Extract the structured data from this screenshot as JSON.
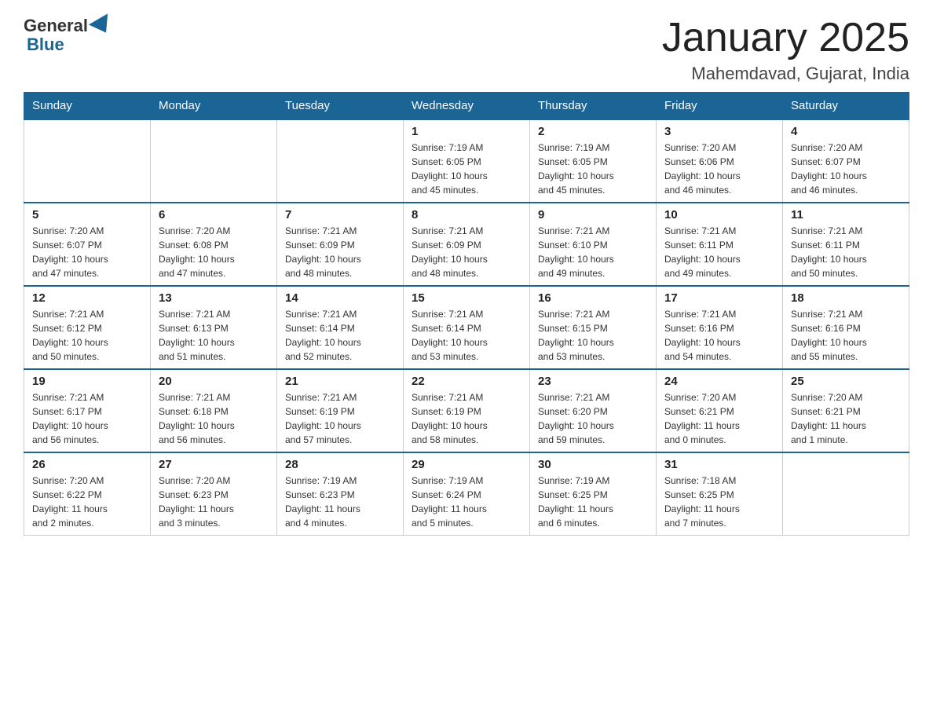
{
  "header": {
    "logo_general": "General",
    "logo_blue": "Blue",
    "month_title": "January 2025",
    "location": "Mahemdavad, Gujarat, India"
  },
  "weekdays": [
    "Sunday",
    "Monday",
    "Tuesday",
    "Wednesday",
    "Thursday",
    "Friday",
    "Saturday"
  ],
  "weeks": [
    [
      {
        "day": "",
        "info": ""
      },
      {
        "day": "",
        "info": ""
      },
      {
        "day": "",
        "info": ""
      },
      {
        "day": "1",
        "info": "Sunrise: 7:19 AM\nSunset: 6:05 PM\nDaylight: 10 hours\nand 45 minutes."
      },
      {
        "day": "2",
        "info": "Sunrise: 7:19 AM\nSunset: 6:05 PM\nDaylight: 10 hours\nand 45 minutes."
      },
      {
        "day": "3",
        "info": "Sunrise: 7:20 AM\nSunset: 6:06 PM\nDaylight: 10 hours\nand 46 minutes."
      },
      {
        "day": "4",
        "info": "Sunrise: 7:20 AM\nSunset: 6:07 PM\nDaylight: 10 hours\nand 46 minutes."
      }
    ],
    [
      {
        "day": "5",
        "info": "Sunrise: 7:20 AM\nSunset: 6:07 PM\nDaylight: 10 hours\nand 47 minutes."
      },
      {
        "day": "6",
        "info": "Sunrise: 7:20 AM\nSunset: 6:08 PM\nDaylight: 10 hours\nand 47 minutes."
      },
      {
        "day": "7",
        "info": "Sunrise: 7:21 AM\nSunset: 6:09 PM\nDaylight: 10 hours\nand 48 minutes."
      },
      {
        "day": "8",
        "info": "Sunrise: 7:21 AM\nSunset: 6:09 PM\nDaylight: 10 hours\nand 48 minutes."
      },
      {
        "day": "9",
        "info": "Sunrise: 7:21 AM\nSunset: 6:10 PM\nDaylight: 10 hours\nand 49 minutes."
      },
      {
        "day": "10",
        "info": "Sunrise: 7:21 AM\nSunset: 6:11 PM\nDaylight: 10 hours\nand 49 minutes."
      },
      {
        "day": "11",
        "info": "Sunrise: 7:21 AM\nSunset: 6:11 PM\nDaylight: 10 hours\nand 50 minutes."
      }
    ],
    [
      {
        "day": "12",
        "info": "Sunrise: 7:21 AM\nSunset: 6:12 PM\nDaylight: 10 hours\nand 50 minutes."
      },
      {
        "day": "13",
        "info": "Sunrise: 7:21 AM\nSunset: 6:13 PM\nDaylight: 10 hours\nand 51 minutes."
      },
      {
        "day": "14",
        "info": "Sunrise: 7:21 AM\nSunset: 6:14 PM\nDaylight: 10 hours\nand 52 minutes."
      },
      {
        "day": "15",
        "info": "Sunrise: 7:21 AM\nSunset: 6:14 PM\nDaylight: 10 hours\nand 53 minutes."
      },
      {
        "day": "16",
        "info": "Sunrise: 7:21 AM\nSunset: 6:15 PM\nDaylight: 10 hours\nand 53 minutes."
      },
      {
        "day": "17",
        "info": "Sunrise: 7:21 AM\nSunset: 6:16 PM\nDaylight: 10 hours\nand 54 minutes."
      },
      {
        "day": "18",
        "info": "Sunrise: 7:21 AM\nSunset: 6:16 PM\nDaylight: 10 hours\nand 55 minutes."
      }
    ],
    [
      {
        "day": "19",
        "info": "Sunrise: 7:21 AM\nSunset: 6:17 PM\nDaylight: 10 hours\nand 56 minutes."
      },
      {
        "day": "20",
        "info": "Sunrise: 7:21 AM\nSunset: 6:18 PM\nDaylight: 10 hours\nand 56 minutes."
      },
      {
        "day": "21",
        "info": "Sunrise: 7:21 AM\nSunset: 6:19 PM\nDaylight: 10 hours\nand 57 minutes."
      },
      {
        "day": "22",
        "info": "Sunrise: 7:21 AM\nSunset: 6:19 PM\nDaylight: 10 hours\nand 58 minutes."
      },
      {
        "day": "23",
        "info": "Sunrise: 7:21 AM\nSunset: 6:20 PM\nDaylight: 10 hours\nand 59 minutes."
      },
      {
        "day": "24",
        "info": "Sunrise: 7:20 AM\nSunset: 6:21 PM\nDaylight: 11 hours\nand 0 minutes."
      },
      {
        "day": "25",
        "info": "Sunrise: 7:20 AM\nSunset: 6:21 PM\nDaylight: 11 hours\nand 1 minute."
      }
    ],
    [
      {
        "day": "26",
        "info": "Sunrise: 7:20 AM\nSunset: 6:22 PM\nDaylight: 11 hours\nand 2 minutes."
      },
      {
        "day": "27",
        "info": "Sunrise: 7:20 AM\nSunset: 6:23 PM\nDaylight: 11 hours\nand 3 minutes."
      },
      {
        "day": "28",
        "info": "Sunrise: 7:19 AM\nSunset: 6:23 PM\nDaylight: 11 hours\nand 4 minutes."
      },
      {
        "day": "29",
        "info": "Sunrise: 7:19 AM\nSunset: 6:24 PM\nDaylight: 11 hours\nand 5 minutes."
      },
      {
        "day": "30",
        "info": "Sunrise: 7:19 AM\nSunset: 6:25 PM\nDaylight: 11 hours\nand 6 minutes."
      },
      {
        "day": "31",
        "info": "Sunrise: 7:18 AM\nSunset: 6:25 PM\nDaylight: 11 hours\nand 7 minutes."
      },
      {
        "day": "",
        "info": ""
      }
    ]
  ]
}
